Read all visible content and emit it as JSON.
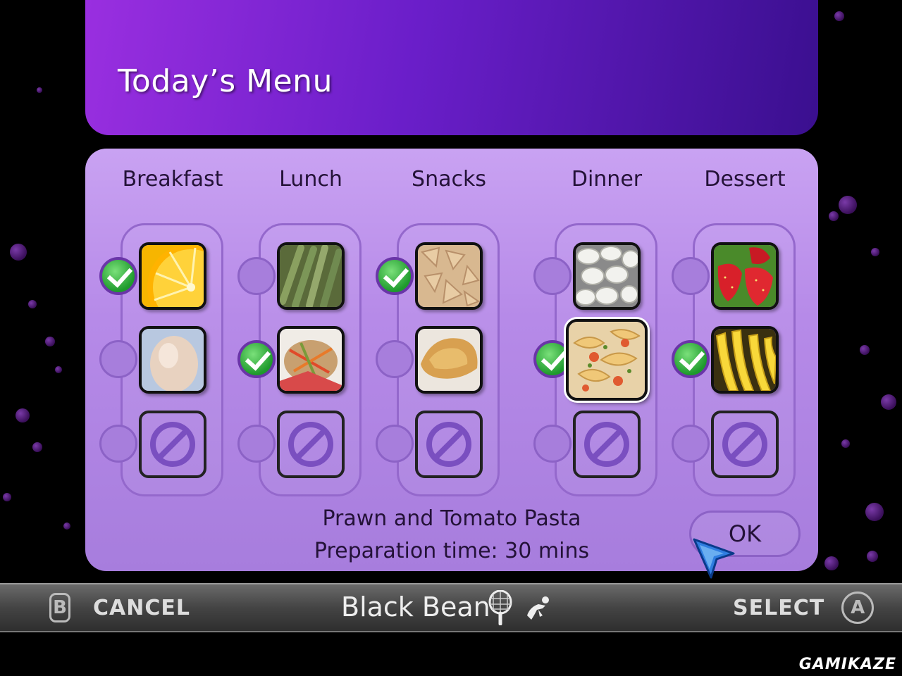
{
  "header": {
    "title": "Today’s Menu"
  },
  "columns": [
    {
      "label": "Breakfast",
      "items": [
        {
          "food": "orange",
          "checked": true
        },
        {
          "food": "egg",
          "checked": false
        },
        {
          "food": "none",
          "checked": false
        }
      ]
    },
    {
      "label": "Lunch",
      "items": [
        {
          "food": "asparagus",
          "checked": false
        },
        {
          "food": "salad",
          "checked": true
        },
        {
          "food": "none",
          "checked": false
        }
      ]
    },
    {
      "label": "Snacks",
      "items": [
        {
          "food": "cereal-flakes",
          "checked": true
        },
        {
          "food": "pastry",
          "checked": false
        },
        {
          "food": "none",
          "checked": false
        }
      ]
    },
    {
      "label": "Dinner",
      "items": [
        {
          "food": "white-beans",
          "checked": false
        },
        {
          "food": "prawn-pasta",
          "checked": true
        },
        {
          "food": "none",
          "checked": false
        }
      ]
    },
    {
      "label": "Dessert",
      "items": [
        {
          "food": "strawberries",
          "checked": false
        },
        {
          "food": "bananas",
          "checked": true
        },
        {
          "food": "none",
          "checked": false
        }
      ]
    }
  ],
  "selection": {
    "dish_name": "Prawn and Tomato Pasta",
    "prep_time": "Preparation time: 30 mins"
  },
  "ok_label": "OK",
  "footer": {
    "cancel_button": "B",
    "cancel_label": "CANCEL",
    "profile_name": "Black Bean",
    "select_label": "SELECT",
    "select_button": "A"
  },
  "watermark": "GAMIKAZE",
  "colors": {
    "header_purple": "#6a1ec9",
    "panel_lavender": "#b68ae8",
    "check_green": "#1e9a2c",
    "cursor_blue": "#2f7de0"
  }
}
